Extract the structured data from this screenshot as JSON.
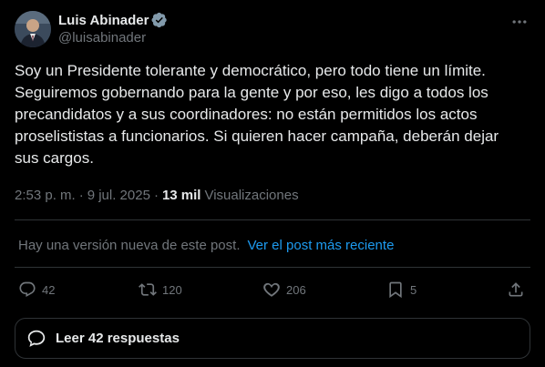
{
  "author": {
    "name": "Luis Abinader",
    "handle": "@luisabinader"
  },
  "tweet": {
    "text": "Soy un Presidente tolerante y democrático, pero todo tiene un límite.\nSeguiremos gobernando para la gente y por eso, les digo a todos los\nprecandidatos y a sus coordinadores: no están permitidos los actos\nproselististas a funcionarios. Si quieren hacer campaña, deberán dejar\nsus cargos."
  },
  "meta": {
    "time": "2:53 p. m.",
    "separator": "·",
    "date": "9 jul. 2025",
    "views_count": "13 mil",
    "views_label": "Visualizaciones"
  },
  "notice": {
    "text": "Hay una versión nueva de este post.",
    "link": "Ver el post más reciente"
  },
  "actions": {
    "replies": "42",
    "reposts": "120",
    "likes": "206",
    "bookmarks": "5"
  },
  "read_replies": {
    "label": "Leer 42 respuestas"
  },
  "colors": {
    "background": "#000000",
    "text": "#e7e9ea",
    "muted": "#71767b",
    "link": "#1d9bf0",
    "border": "#2f3336"
  },
  "icons": [
    "verified-badge-icon",
    "more-icon",
    "reply-icon",
    "repost-icon",
    "like-icon",
    "bookmark-icon",
    "share-icon",
    "speech-bubble-icon"
  ]
}
